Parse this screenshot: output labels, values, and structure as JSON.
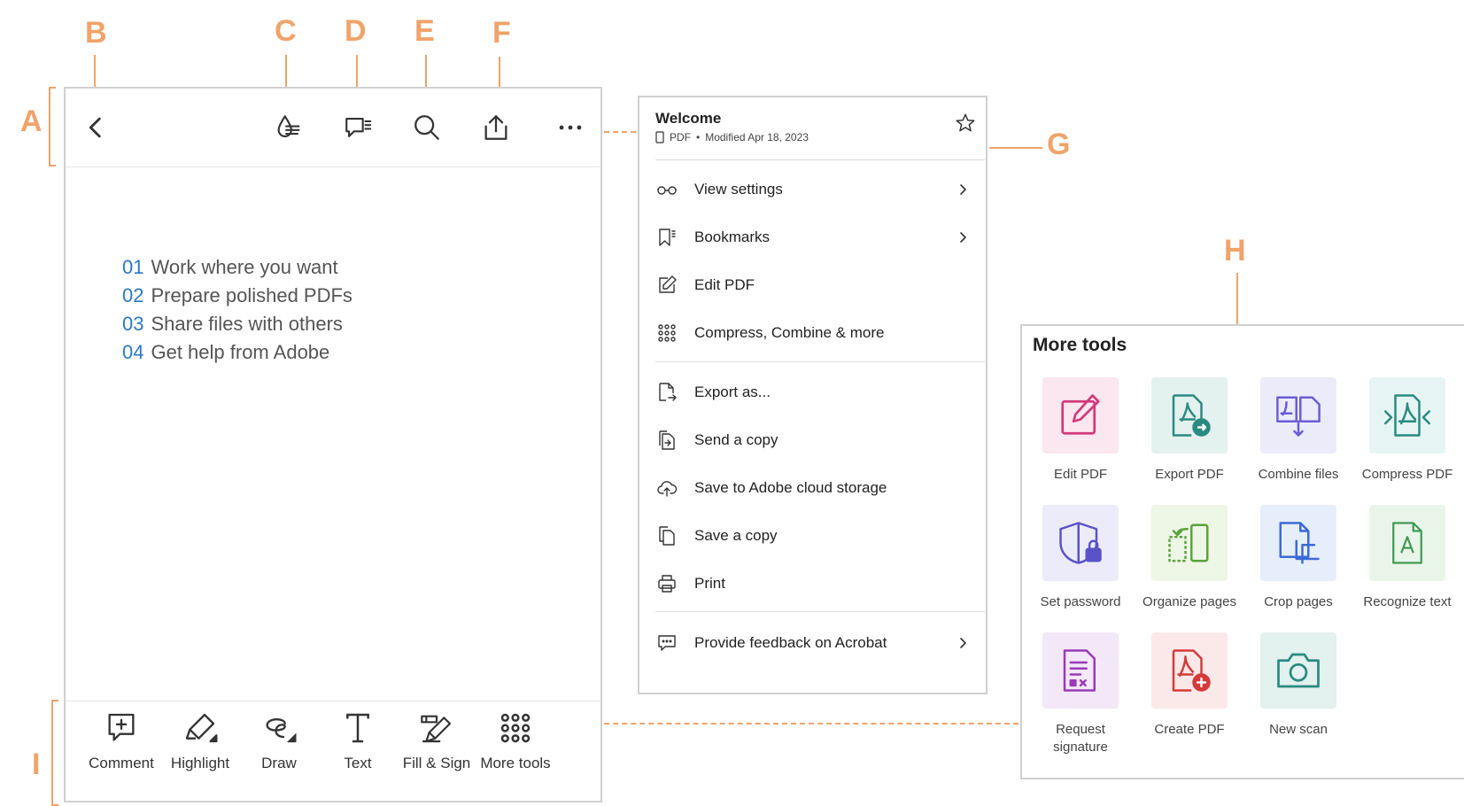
{
  "callouts": {
    "a": "A",
    "b": "B",
    "c": "C",
    "d": "D",
    "e": "E",
    "f": "F",
    "g": "G",
    "h": "H",
    "i": "I"
  },
  "colors": {
    "callout": "#f0a36a",
    "accent_blue": "#2b79c2",
    "frame_border": "#d0d0d0"
  },
  "toolbar": {
    "icons": [
      "back-chevron-icon",
      "liquid-mode-icon",
      "comments-list-icon",
      "search-icon",
      "share-icon",
      "more-icon"
    ]
  },
  "document": {
    "lines": [
      {
        "num": "01",
        "text": "Work where you want"
      },
      {
        "num": "02",
        "text": "Prepare polished PDFs"
      },
      {
        "num": "03",
        "text": "Share files with others"
      },
      {
        "num": "04",
        "text": "Get help from Adobe"
      }
    ]
  },
  "bottom_bar": {
    "items": [
      {
        "label": "Comment",
        "icon": "comment-add-icon"
      },
      {
        "label": "Highlight",
        "icon": "highlighter-icon"
      },
      {
        "label": "Draw",
        "icon": "draw-icon"
      },
      {
        "label": "Text",
        "icon": "text-icon"
      },
      {
        "label": "Fill & Sign",
        "icon": "fill-sign-icon"
      },
      {
        "label": "More tools",
        "icon": "grid-icon"
      }
    ]
  },
  "menu": {
    "title": "Welcome",
    "file_type": "PDF",
    "separator": "•",
    "modified": "Modified Apr 18, 2023",
    "items": [
      {
        "label": "View settings",
        "icon": "glasses-icon",
        "chevron": true
      },
      {
        "label": "Bookmarks",
        "icon": "bookmark-icon",
        "chevron": true
      },
      {
        "label": "Edit PDF",
        "icon": "edit-icon",
        "chevron": false
      },
      {
        "label": "Compress, Combine & more",
        "icon": "grid-icon",
        "chevron": false
      },
      {
        "label": "Export as...",
        "icon": "export-icon",
        "chevron": false
      },
      {
        "label": "Send a copy",
        "icon": "send-copy-icon",
        "chevron": false
      },
      {
        "label": "Save to Adobe cloud storage",
        "icon": "cloud-upload-icon",
        "chevron": false
      },
      {
        "label": "Save a copy",
        "icon": "copy-icon",
        "chevron": false
      },
      {
        "label": "Print",
        "icon": "print-icon",
        "chevron": false
      },
      {
        "label": "Provide feedback on Acrobat",
        "icon": "feedback-icon",
        "chevron": true
      }
    ]
  },
  "more_tools": {
    "title": "More tools",
    "items": [
      {
        "label": "Edit PDF",
        "icon": "edit-pdf-icon",
        "tile_color": "#fbe7ef",
        "icon_color": "#d13a7a"
      },
      {
        "label": "Export PDF",
        "icon": "export-pdf-icon",
        "tile_color": "#e3f1ef",
        "icon_color": "#2a8a80"
      },
      {
        "label": "Combine files",
        "icon": "combine-files-icon",
        "tile_color": "#ecebfa",
        "icon_color": "#6b5cd6"
      },
      {
        "label": "Compress PDF",
        "icon": "compress-pdf-icon",
        "tile_color": "#e6f5f4",
        "icon_color": "#2a8a80"
      },
      {
        "label": "Set password",
        "icon": "set-password-icon",
        "tile_color": "#ecebfa",
        "icon_color": "#5a52c8"
      },
      {
        "label": "Organize pages",
        "icon": "organize-pages-icon",
        "tile_color": "#eef6e6",
        "icon_color": "#5aa33a"
      },
      {
        "label": "Crop pages",
        "icon": "crop-pages-icon",
        "tile_color": "#e6eefc",
        "icon_color": "#3a6ad6"
      },
      {
        "label": "Recognize text",
        "icon": "recognize-text-icon",
        "tile_color": "#eaf5ea",
        "icon_color": "#3f9a55"
      },
      {
        "label": "Request signature",
        "icon": "request-signature-icon",
        "tile_color": "#f3e8f8",
        "icon_color": "#9a3ab8"
      },
      {
        "label": "Create PDF",
        "icon": "create-pdf-icon",
        "tile_color": "#fbe9e9",
        "icon_color": "#d43a3a"
      },
      {
        "label": "New scan",
        "icon": "new-scan-icon",
        "tile_color": "#e3f1ef",
        "icon_color": "#2a8a80"
      }
    ]
  }
}
